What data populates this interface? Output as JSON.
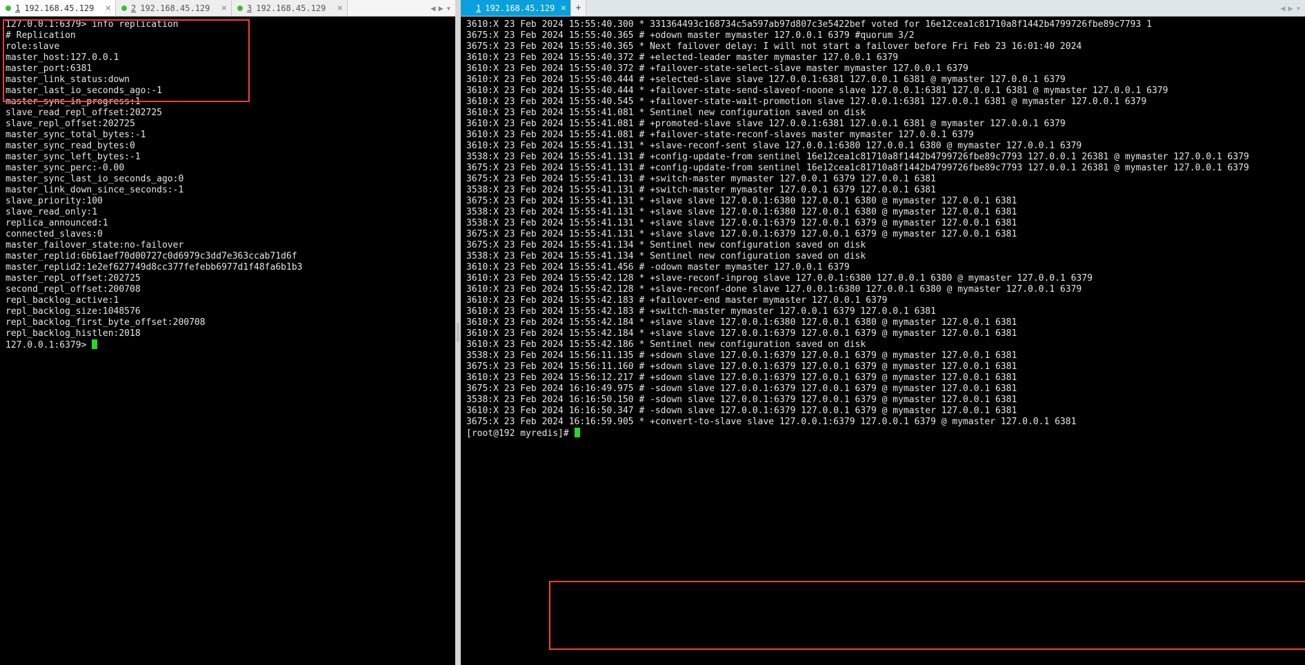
{
  "left": {
    "tabs": [
      {
        "num": "1",
        "label": "192.168.45.129",
        "active": true
      },
      {
        "num": "2",
        "label": "192.168.45.129",
        "active": false
      },
      {
        "num": "3",
        "label": "192.168.45.129",
        "active": false
      }
    ],
    "prompt": "127.0.0.1:6379>",
    "command": "info replication",
    "output": [
      "# Replication",
      "role:slave",
      "master_host:127.0.0.1",
      "master_port:6381",
      "master_link_status:down",
      "master_last_io_seconds_ago:-1",
      "master_sync_in_progress:1",
      "slave_read_repl_offset:202725",
      "slave_repl_offset:202725",
      "master_sync_total_bytes:-1",
      "master_sync_read_bytes:0",
      "master_sync_left_bytes:-1",
      "master_sync_perc:-0.00",
      "master_sync_last_io_seconds_ago:0",
      "master_link_down_since_seconds:-1",
      "slave_priority:100",
      "slave_read_only:1",
      "replica_announced:1",
      "connected_slaves:0",
      "master_failover_state:no-failover",
      "master_replid:6b61aef70d00727c0d6979c3dd7e363ccab71d6f",
      "master_replid2:1e2ef627749d8cc377fefebb6977d1f48fa6b1b3",
      "master_repl_offset:202725",
      "second_repl_offset:200708",
      "repl_backlog_active:1",
      "repl_backlog_size:1048576",
      "repl_backlog_first_byte_offset:200708",
      "repl_backlog_histlen:2018"
    ],
    "prompt2": "127.0.0.1:6379>"
  },
  "right": {
    "tabs": [
      {
        "num": "1",
        "label": "192.168.45.129",
        "active": true
      }
    ],
    "addTab": "+",
    "lines": [
      "3610:X 23 Feb 2024 15:55:40.300 * 331364493c168734c5a597ab97d807c3e5422bef voted for 16e12cea1c81710a8f1442b4799726fbe89c7793 1",
      "3675:X 23 Feb 2024 15:55:40.365 # +odown master mymaster 127.0.0.1 6379 #quorum 3/2",
      "3675:X 23 Feb 2024 15:55:40.365 * Next failover delay: I will not start a failover before Fri Feb 23 16:01:40 2024",
      "3610:X 23 Feb 2024 15:55:40.372 # +elected-leader master mymaster 127.0.0.1 6379",
      "3610:X 23 Feb 2024 15:55:40.372 # +failover-state-select-slave master mymaster 127.0.0.1 6379",
      "3610:X 23 Feb 2024 15:55:40.444 # +selected-slave slave 127.0.0.1:6381 127.0.0.1 6381 @ mymaster 127.0.0.1 6379",
      "3610:X 23 Feb 2024 15:55:40.444 * +failover-state-send-slaveof-noone slave 127.0.0.1:6381 127.0.0.1 6381 @ mymaster 127.0.0.1 6379",
      "3610:X 23 Feb 2024 15:55:40.545 * +failover-state-wait-promotion slave 127.0.0.1:6381 127.0.0.1 6381 @ mymaster 127.0.0.1 6379",
      "3610:X 23 Feb 2024 15:55:41.081 * Sentinel new configuration saved on disk",
      "3610:X 23 Feb 2024 15:55:41.081 # +promoted-slave slave 127.0.0.1:6381 127.0.0.1 6381 @ mymaster 127.0.0.1 6379",
      "3610:X 23 Feb 2024 15:55:41.081 # +failover-state-reconf-slaves master mymaster 127.0.0.1 6379",
      "3610:X 23 Feb 2024 15:55:41.131 * +slave-reconf-sent slave 127.0.0.1:6380 127.0.0.1 6380 @ mymaster 127.0.0.1 6379",
      "3538:X 23 Feb 2024 15:55:41.131 # +config-update-from sentinel 16e12cea1c81710a8f1442b4799726fbe89c7793 127.0.0.1 26381 @ mymaster 127.0.0.1 6379",
      "3675:X 23 Feb 2024 15:55:41.131 # +config-update-from sentinel 16e12cea1c81710a8f1442b4799726fbe89c7793 127.0.0.1 26381 @ mymaster 127.0.0.1 6379",
      "3675:X 23 Feb 2024 15:55:41.131 # +switch-master mymaster 127.0.0.1 6379 127.0.0.1 6381",
      "3538:X 23 Feb 2024 15:55:41.131 # +switch-master mymaster 127.0.0.1 6379 127.0.0.1 6381",
      "3675:X 23 Feb 2024 15:55:41.131 * +slave slave 127.0.0.1:6380 127.0.0.1 6380 @ mymaster 127.0.0.1 6381",
      "3538:X 23 Feb 2024 15:55:41.131 * +slave slave 127.0.0.1:6380 127.0.0.1 6380 @ mymaster 127.0.0.1 6381",
      "3538:X 23 Feb 2024 15:55:41.131 * +slave slave 127.0.0.1:6379 127.0.0.1 6379 @ mymaster 127.0.0.1 6381",
      "3675:X 23 Feb 2024 15:55:41.131 * +slave slave 127.0.0.1:6379 127.0.0.1 6379 @ mymaster 127.0.0.1 6381",
      "3675:X 23 Feb 2024 15:55:41.134 * Sentinel new configuration saved on disk",
      "3538:X 23 Feb 2024 15:55:41.134 * Sentinel new configuration saved on disk",
      "3610:X 23 Feb 2024 15:55:41.456 # -odown master mymaster 127.0.0.1 6379",
      "3610:X 23 Feb 2024 15:55:42.128 * +slave-reconf-inprog slave 127.0.0.1:6380 127.0.0.1 6380 @ mymaster 127.0.0.1 6379",
      "3610:X 23 Feb 2024 15:55:42.128 * +slave-reconf-done slave 127.0.0.1:6380 127.0.0.1 6380 @ mymaster 127.0.0.1 6379",
      "3610:X 23 Feb 2024 15:55:42.183 # +failover-end master mymaster 127.0.0.1 6379",
      "3610:X 23 Feb 2024 15:55:42.183 # +switch-master mymaster 127.0.0.1 6379 127.0.0.1 6381",
      "3610:X 23 Feb 2024 15:55:42.184 * +slave slave 127.0.0.1:6380 127.0.0.1 6380 @ mymaster 127.0.0.1 6381",
      "3610:X 23 Feb 2024 15:55:42.184 * +slave slave 127.0.0.1:6379 127.0.0.1 6379 @ mymaster 127.0.0.1 6381",
      "3610:X 23 Feb 2024 15:55:42.186 * Sentinel new configuration saved on disk",
      "3538:X 23 Feb 2024 15:56:11.135 # +sdown slave 127.0.0.1:6379 127.0.0.1 6379 @ mymaster 127.0.0.1 6381",
      "3675:X 23 Feb 2024 15:56:11.160 # +sdown slave 127.0.0.1:6379 127.0.0.1 6379 @ mymaster 127.0.0.1 6381",
      "3610:X 23 Feb 2024 15:56:12.217 # +sdown slave 127.0.0.1:6379 127.0.0.1 6379 @ mymaster 127.0.0.1 6381",
      "3675:X 23 Feb 2024 16:16:49.975 # -sdown slave 127.0.0.1:6379 127.0.0.1 6379 @ mymaster 127.0.0.1 6381",
      "3538:X 23 Feb 2024 16:16:50.150 # -sdown slave 127.0.0.1:6379 127.0.0.1 6379 @ mymaster 127.0.0.1 6381",
      "3610:X 23 Feb 2024 16:16:50.347 # -sdown slave 127.0.0.1:6379 127.0.0.1 6379 @ mymaster 127.0.0.1 6381",
      "3675:X 23 Feb 2024 16:16:59.905 * +convert-to-slave slave 127.0.0.1:6379 127.0.0.1 6379 @ mymaster 127.0.0.1 6381"
    ],
    "shellPrompt": "[root@192 myredis]#"
  },
  "colors": {
    "tabActiveBlue": "#0aa0dd",
    "statusGreen": "#3bbd3b",
    "highlightRed": "#ff3b3b",
    "cursorGreen": "#29d629"
  }
}
